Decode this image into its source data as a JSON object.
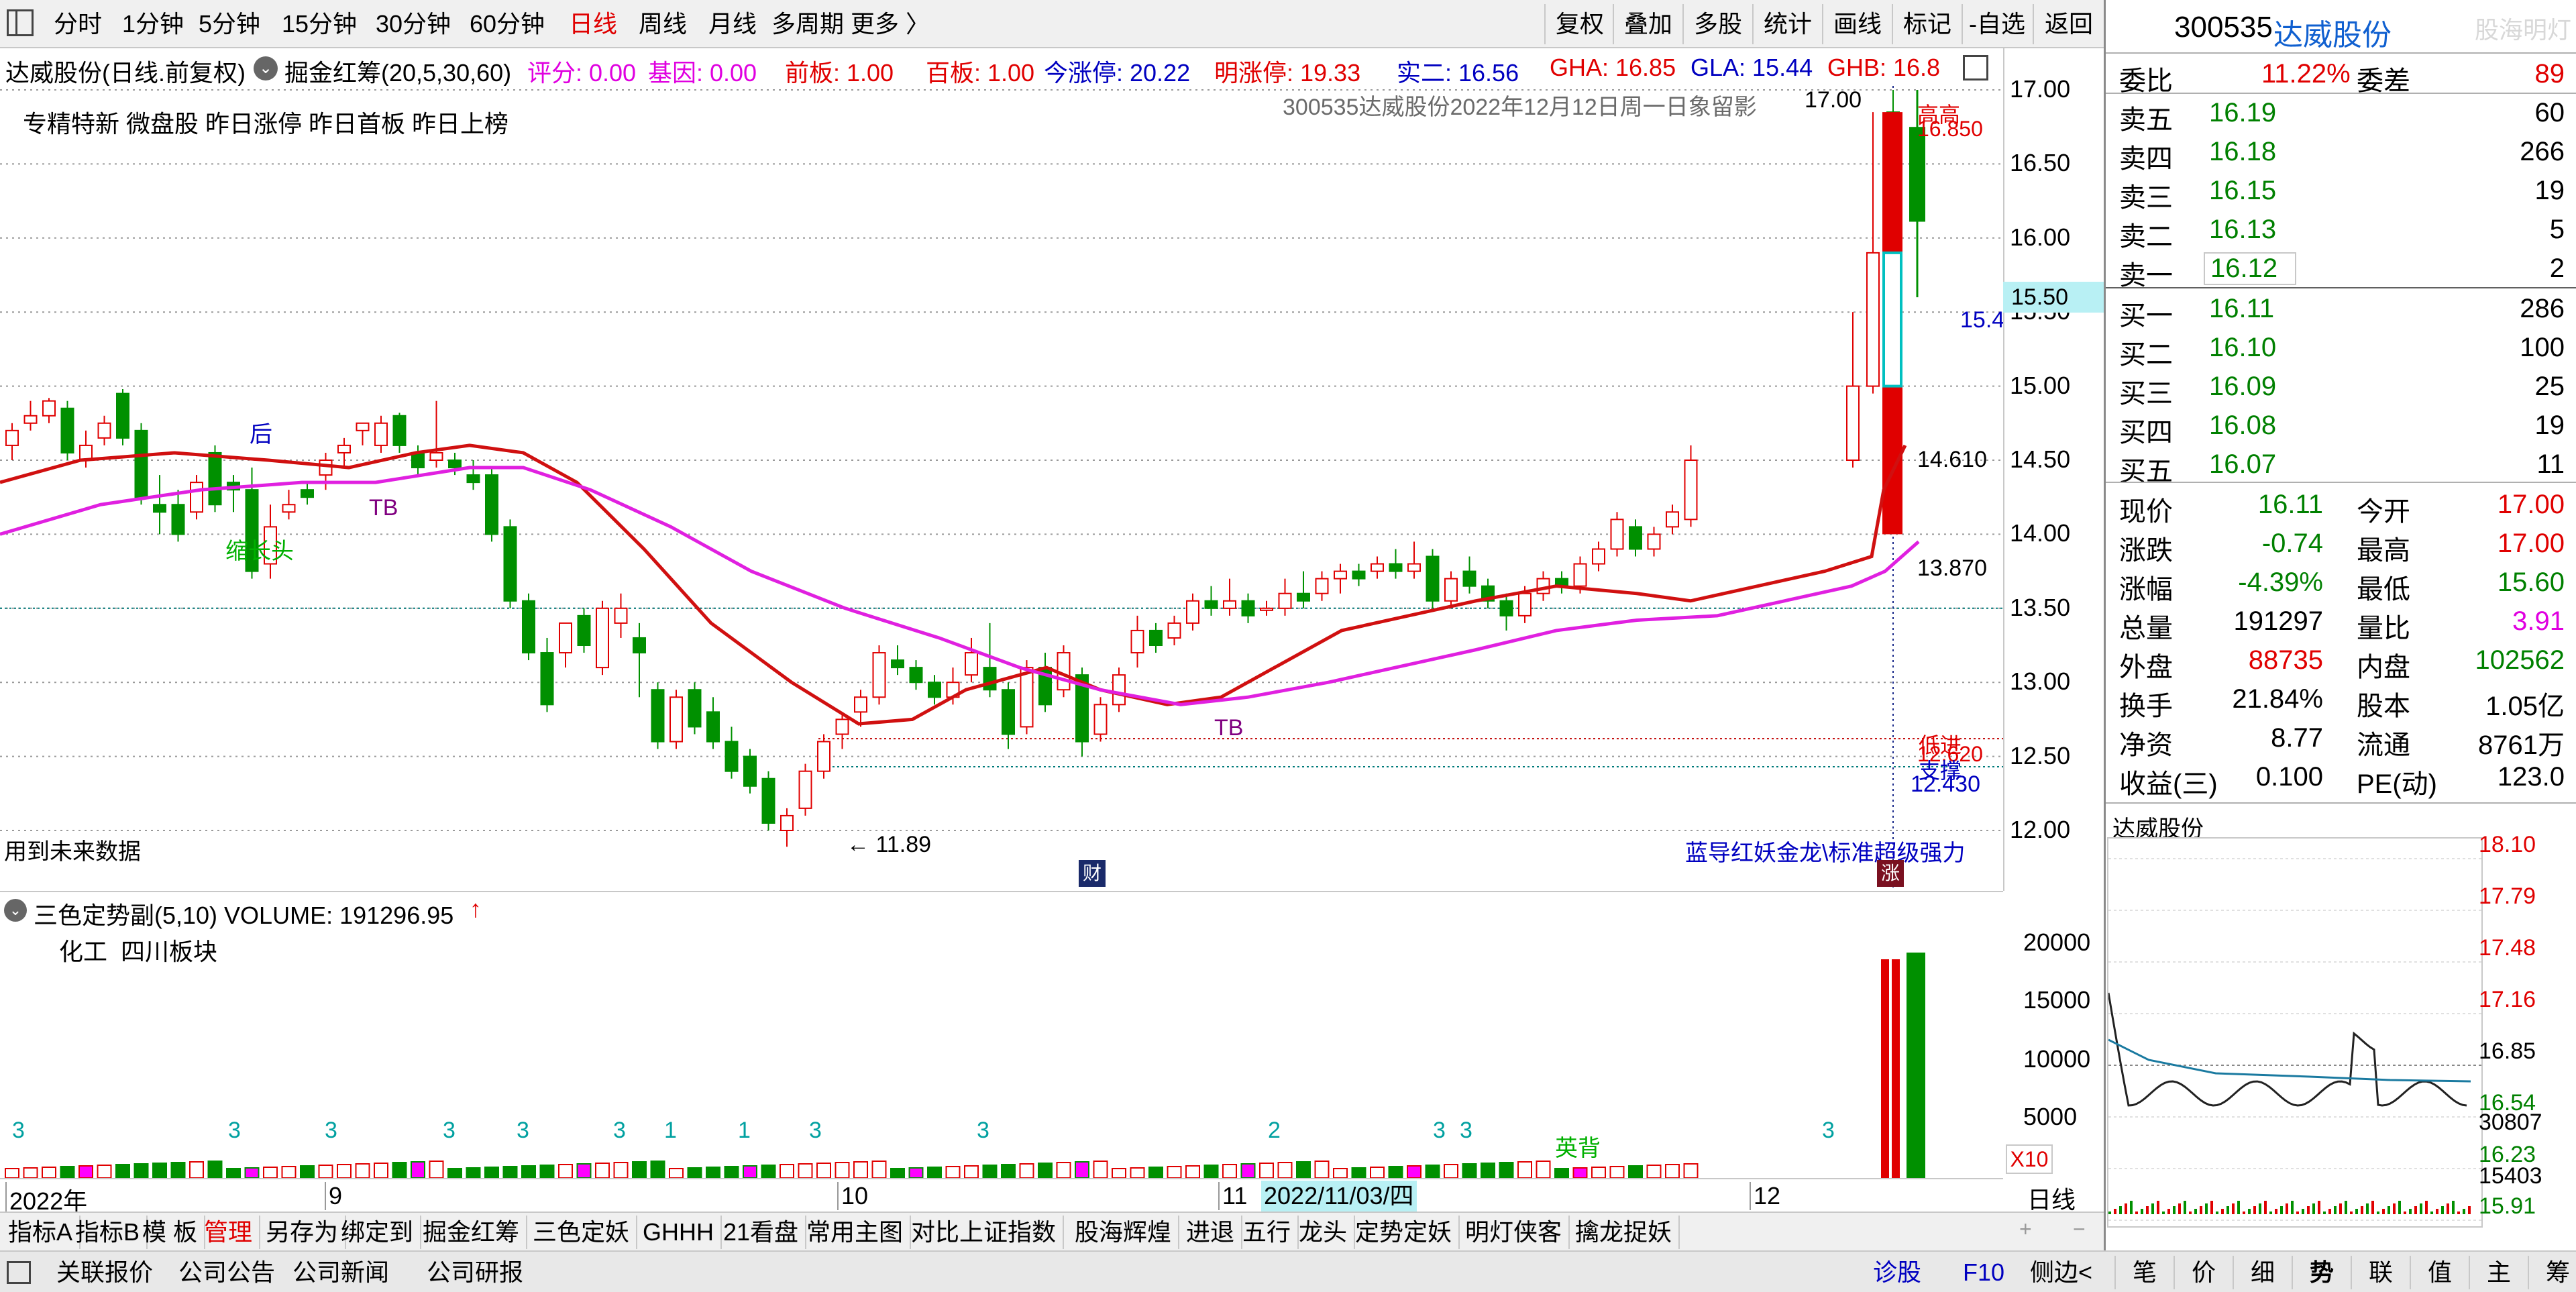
{
  "toolbar": {
    "periods": [
      "分时",
      "1分钟",
      "5分钟",
      "15分钟",
      "30分钟",
      "60分钟",
      "日线",
      "周线",
      "月线",
      "多周期",
      "更多 〉"
    ],
    "active_period": "日线",
    "right_buttons": [
      "复权",
      "叠加",
      "多股",
      "统计",
      "画线",
      "标记",
      "-自选",
      "返回"
    ]
  },
  "info": {
    "stock_title": "达威股份(日线.前复权)",
    "indicator": "掘金红筹(20,5,30,60)",
    "score": "评分: 0.00",
    "jiyin": "基因: 0.00",
    "qianban": "前板: 1.00",
    "baiban": "百板: 1.00",
    "jinzhangting": "今涨停: 20.22",
    "mingzhangting": "明涨停: 19.33",
    "maier": "实二: 16.56",
    "gha": "GHA: 16.85",
    "gla": "GLA: 15.44",
    "ghb": "GHB: 16.8"
  },
  "chart": {
    "tags": "专精特新 微盘股 昨日涨停 昨日首板 昨日上榜",
    "watermark": "300535达威股份2022年12月12日周一日象留影",
    "future_note": "用到未来数据",
    "signal_text": "蓝导红妖金龙\\标准超级强力",
    "labels": {
      "hou": "后",
      "tb1": "TB",
      "suochang": "缩长头",
      "tb2": "TB",
      "low": "← 11.89",
      "high": "17.00",
      "gaoxin": "高高",
      "p16850": "16.850",
      "p14610": "14.610",
      "p13870": "13.870",
      "p12620": "12.620",
      "p12430": "12.430",
      "dijin": "低进",
      "zhicheng": "支撑",
      "p15_4": "15.4",
      "cai": "财",
      "zhang": "涨",
      "price_box": "15.50"
    },
    "y_ticks": [
      "17.00",
      "16.50",
      "16.00",
      "15.50",
      "15.00",
      "14.50",
      "14.00",
      "13.50",
      "13.00",
      "12.50",
      "12.00"
    ]
  },
  "volume": {
    "header": "三色定势副(5,10) VOLUME: 191296.95",
    "sector": "化工  四川板块",
    "y_ticks": [
      "20000",
      "15000",
      "10000",
      "5000"
    ],
    "x10": "X10",
    "yingbei": "英背",
    "months": [
      "2022年",
      "9",
      "10",
      "11",
      "12"
    ],
    "date_box": "2022/11/03/四",
    "counts": [
      "3",
      "3",
      "3",
      "3",
      "3",
      "3",
      "1",
      "1",
      "3",
      "3",
      "2",
      "3",
      "3",
      "3"
    ]
  },
  "tabs": [
    "指标A",
    "指标B",
    "模 板",
    "管理",
    "另存为",
    "绑定到",
    "掘金红筹",
    "三色定妖",
    "GHHH",
    "21看盘",
    "常用主图",
    "对比上证指数",
    "股海辉煌",
    "进退",
    "五行",
    "龙头",
    "定势定妖",
    "明灯侠客",
    "擒龙捉妖"
  ],
  "tab_right": "日线",
  "status": {
    "left": [
      "关联报价",
      "公司公告",
      "公司新闻",
      "公司研报"
    ],
    "diagnose": "诊股",
    "f10": "F10",
    "side": "侧边<",
    "right": [
      "笔",
      "价",
      "细",
      "势",
      "联",
      "值",
      "主",
      "筹"
    ]
  },
  "quote": {
    "code": "300535",
    "name": "达威股份",
    "brand": "股海明灯",
    "weibi_label": "委比",
    "weibi": "11.22%",
    "weicha_label": "委差",
    "weicha": "89",
    "asks": [
      {
        "label": "卖五",
        "price": "16.19",
        "vol": "60"
      },
      {
        "label": "卖四",
        "price": "16.18",
        "vol": "266"
      },
      {
        "label": "卖三",
        "price": "16.15",
        "vol": "19"
      },
      {
        "label": "卖二",
        "price": "16.13",
        "vol": "5"
      },
      {
        "label": "卖一",
        "price": "16.12",
        "vol": "2"
      }
    ],
    "bids": [
      {
        "label": "买一",
        "price": "16.11",
        "vol": "286"
      },
      {
        "label": "买二",
        "price": "16.10",
        "vol": "100"
      },
      {
        "label": "买三",
        "price": "16.09",
        "vol": "25"
      },
      {
        "label": "买四",
        "price": "16.08",
        "vol": "19"
      },
      {
        "label": "买五",
        "price": "16.07",
        "vol": "11"
      }
    ],
    "stats": [
      {
        "l1": "现价",
        "v1": "16.11",
        "c1": "green",
        "l2": "今开",
        "v2": "17.00",
        "c2": "red"
      },
      {
        "l1": "涨跌",
        "v1": "-0.74",
        "c1": "green",
        "l2": "最高",
        "v2": "17.00",
        "c2": "red"
      },
      {
        "l1": "涨幅",
        "v1": "-4.39%",
        "c1": "green",
        "l2": "最低",
        "v2": "15.60",
        "c2": "green"
      },
      {
        "l1": "总量",
        "v1": "191297",
        "c1": "black",
        "l2": "量比",
        "v2": "3.91",
        "c2": "magenta"
      },
      {
        "l1": "外盘",
        "v1": "88735",
        "c1": "red",
        "l2": "内盘",
        "v2": "102562",
        "c2": "green"
      },
      {
        "l1": "换手",
        "v1": "21.84%",
        "c1": "black",
        "l2": "股本",
        "v2": "1.05亿",
        "c2": "black"
      },
      {
        "l1": "净资",
        "v1": "8.77",
        "c1": "black",
        "l2": "流通",
        "v2": "8761万",
        "c2": "black"
      },
      {
        "l1": "收益(三)",
        "v1": "0.100",
        "c1": "black",
        "l2": "PE(动)",
        "v2": "123.0",
        "c2": "black"
      }
    ],
    "mini_title": "达威股份",
    "mini_ticks": [
      {
        "v": "18.10",
        "c": "red"
      },
      {
        "v": "17.79",
        "c": "red"
      },
      {
        "v": "17.48",
        "c": "red"
      },
      {
        "v": "17.16",
        "c": "red"
      },
      {
        "v": "16.85",
        "c": "black"
      },
      {
        "v": "16.54",
        "c": "green"
      },
      {
        "v": "16.23",
        "c": "green"
      },
      {
        "v": "15.91",
        "c": "green"
      }
    ],
    "mini_vol_ticks": [
      "30807",
      "15403"
    ]
  }
}
